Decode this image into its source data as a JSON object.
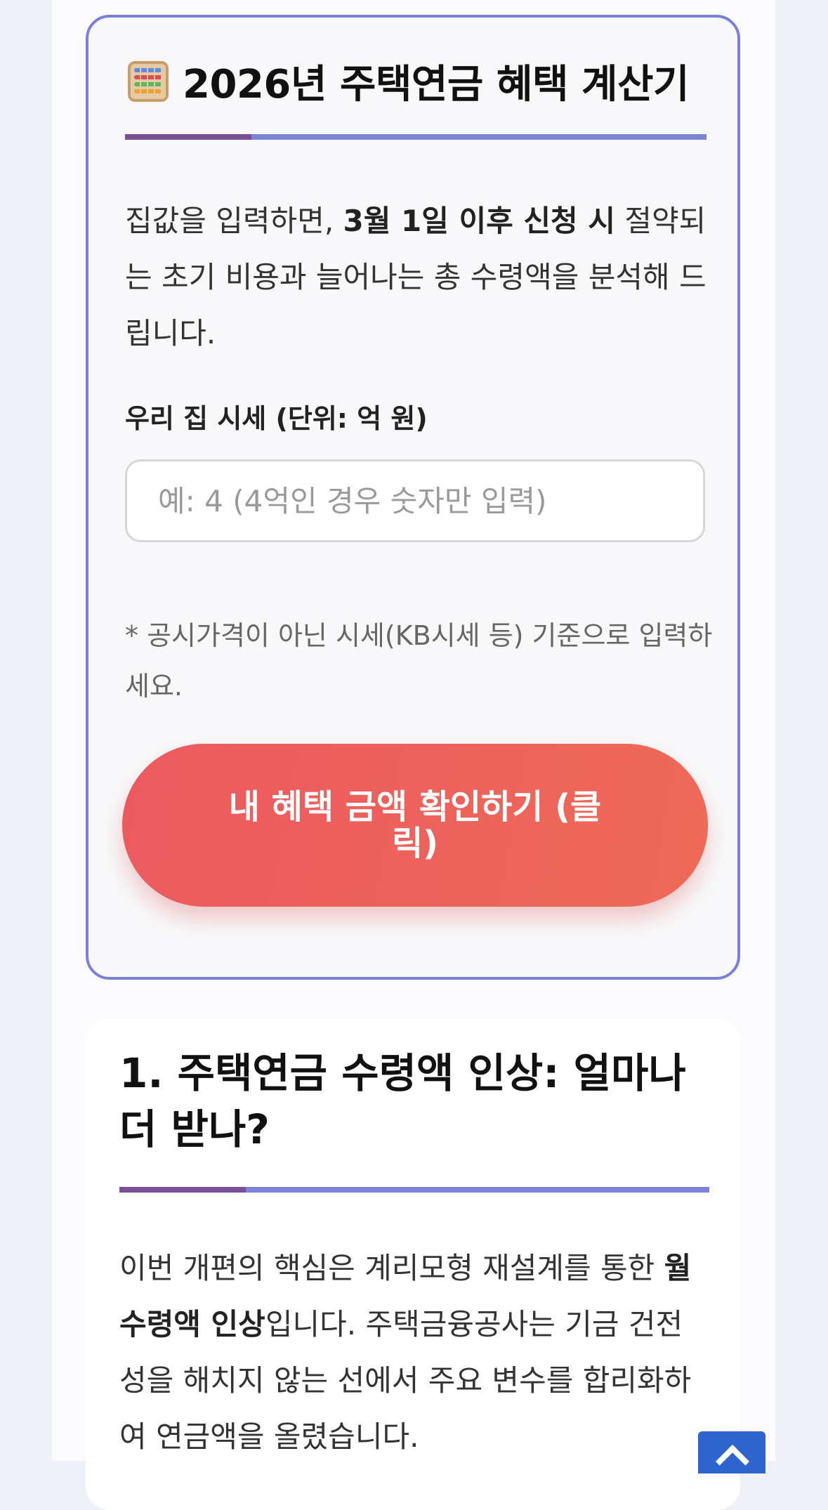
{
  "calculator": {
    "icon": "abacus-icon",
    "title": "2026년 주택연금 혜택 계산기",
    "description": {
      "prefix": "집값을 입력하면, ",
      "bold": "3월 1일 이후 신청 시",
      "suffix": " 절약되는 초기 비용과 늘어나는 총 수령액을 분석해 드립니다."
    },
    "price_label": "우리 집 시세 (단위: 억 원)",
    "price_placeholder": "예: 4 (4억인 경우 숫자만 입력)",
    "price_value": "",
    "note": "* 공시가격이 아닌 시세(KB시세 등) 기준으로 입력하세요.",
    "button_label": "내 혜택 금액 확인하기 (클릭)"
  },
  "section1": {
    "heading": "1. 주택연금 수령액 인상: 얼마나 더 받나?",
    "body": {
      "prefix": "이번 개편의 핵심은 계리모형 재설계를 통한 ",
      "bold": "월 수령액 인상",
      "suffix": "입니다. 주택금융공사는 기금 건전성을 해치지 않는 선에서 주요 변수를 합리화하여 연금액을 올렸습니다."
    }
  },
  "scroll_top": {
    "icon": "chevron-up-icon"
  },
  "colors": {
    "card_border": "#7b7fd9",
    "divider": "#7b83d8",
    "divider_accent": "#7a4f96",
    "button_start": "#ec5a60",
    "button_end": "#ee6a58",
    "scroll_top": "#2f64cf"
  }
}
